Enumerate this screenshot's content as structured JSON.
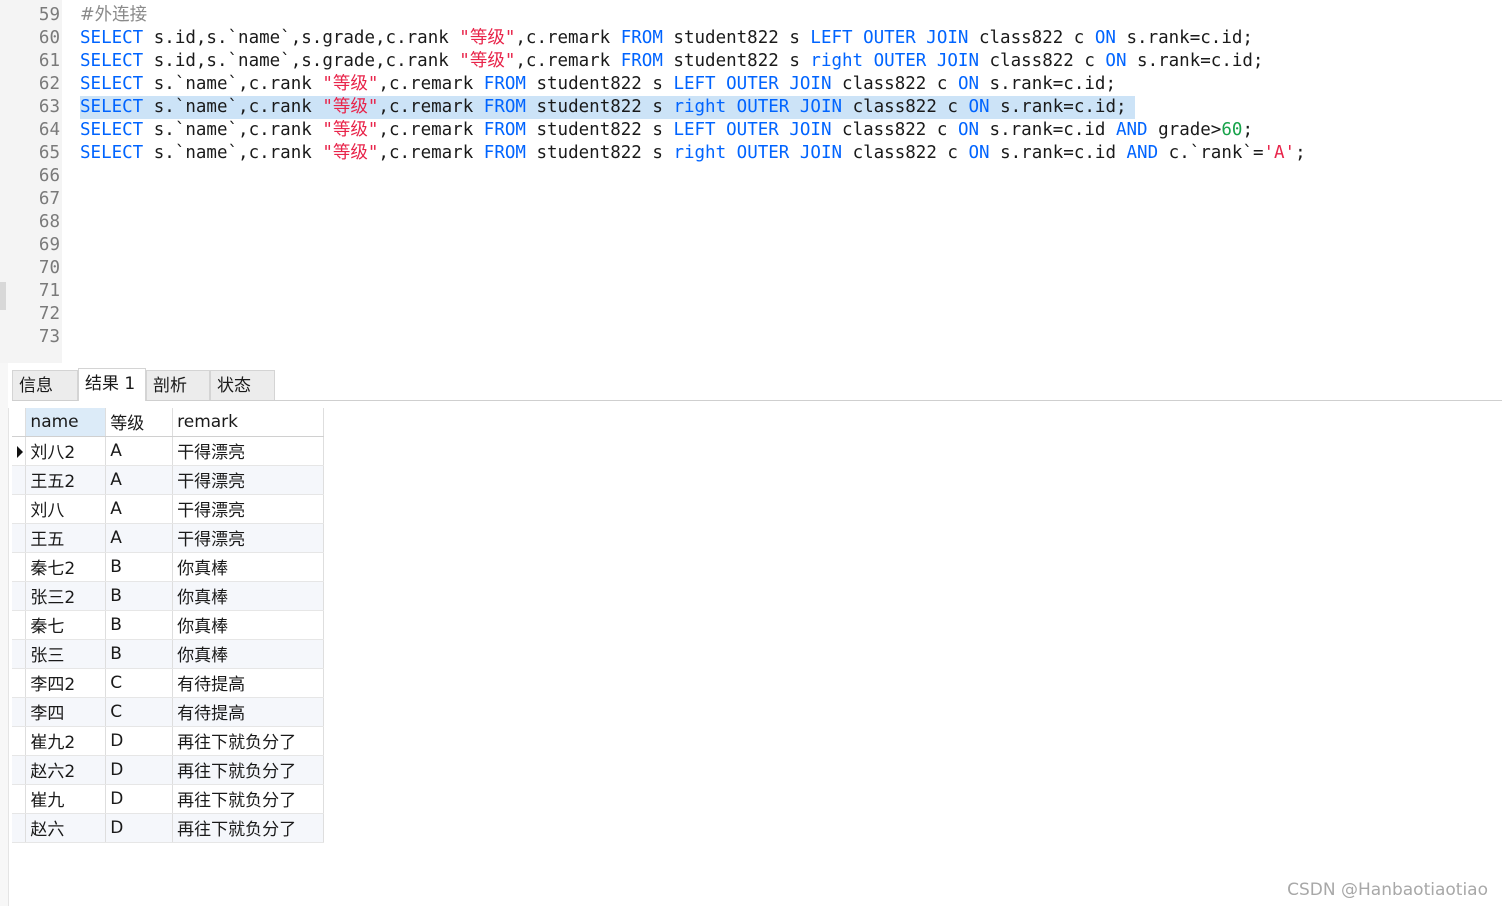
{
  "editor": {
    "lines": [
      {
        "num": "59",
        "highlight": false,
        "tokens": [
          [
            "cm",
            "#外连接"
          ]
        ]
      },
      {
        "num": "60",
        "highlight": false,
        "tokens": [
          [
            "kw",
            "SELECT"
          ],
          [
            "id",
            " s.id,s.`name`,s.grade,c.rank "
          ],
          [
            "str",
            "\"等级\""
          ],
          [
            "id",
            ",c.remark "
          ],
          [
            "kw",
            "FROM"
          ],
          [
            "id",
            " student822 s "
          ],
          [
            "kw",
            "LEFT OUTER JOIN"
          ],
          [
            "id",
            " class822 c "
          ],
          [
            "kw",
            "ON"
          ],
          [
            "id",
            " s.rank=c.id;"
          ]
        ]
      },
      {
        "num": "61",
        "highlight": false,
        "tokens": [
          [
            "kw",
            "SELECT"
          ],
          [
            "id",
            " s.id,s.`name`,s.grade,c.rank "
          ],
          [
            "str",
            "\"等级\""
          ],
          [
            "id",
            ",c.remark "
          ],
          [
            "kw",
            "FROM"
          ],
          [
            "id",
            " student822 s "
          ],
          [
            "kw",
            "right OUTER JOIN"
          ],
          [
            "id",
            " class822 c "
          ],
          [
            "kw",
            "ON"
          ],
          [
            "id",
            " s.rank=c.id;"
          ]
        ]
      },
      {
        "num": "62",
        "highlight": false,
        "tokens": [
          [
            "kw",
            "SELECT"
          ],
          [
            "id",
            " s.`name`,c.rank "
          ],
          [
            "str",
            "\"等级\""
          ],
          [
            "id",
            ",c.remark "
          ],
          [
            "kw",
            "FROM"
          ],
          [
            "id",
            " student822 s "
          ],
          [
            "kw",
            "LEFT OUTER JOIN"
          ],
          [
            "id",
            " class822 c "
          ],
          [
            "kw",
            "ON"
          ],
          [
            "id",
            " s.rank=c.id;"
          ]
        ]
      },
      {
        "num": "63",
        "highlight": true,
        "tokens": [
          [
            "kw",
            "SELECT"
          ],
          [
            "id",
            " s.`name`,c.rank "
          ],
          [
            "str",
            "\"等级\""
          ],
          [
            "id",
            ",c.remark "
          ],
          [
            "kw",
            "FROM"
          ],
          [
            "id",
            " student822 s "
          ],
          [
            "kw",
            "right OUTER JOIN"
          ],
          [
            "id",
            " class822 c "
          ],
          [
            "kw",
            "ON"
          ],
          [
            "id",
            " s.rank=c.id;"
          ]
        ]
      },
      {
        "num": "64",
        "highlight": false,
        "tokens": [
          [
            "kw",
            "SELECT"
          ],
          [
            "id",
            " s.`name`,c.rank "
          ],
          [
            "str",
            "\"等级\""
          ],
          [
            "id",
            ",c.remark "
          ],
          [
            "kw",
            "FROM"
          ],
          [
            "id",
            " student822 s "
          ],
          [
            "kw",
            "LEFT OUTER JOIN"
          ],
          [
            "id",
            " class822 c "
          ],
          [
            "kw",
            "ON"
          ],
          [
            "id",
            " s.rank=c.id "
          ],
          [
            "kw",
            "AND"
          ],
          [
            "id",
            " grade>"
          ],
          [
            "num",
            "60"
          ],
          [
            "id",
            ";"
          ]
        ]
      },
      {
        "num": "65",
        "highlight": false,
        "tokens": [
          [
            "kw",
            "SELECT"
          ],
          [
            "id",
            " s.`name`,c.rank "
          ],
          [
            "str",
            "\"等级\""
          ],
          [
            "id",
            ",c.remark "
          ],
          [
            "kw",
            "FROM"
          ],
          [
            "id",
            " student822 s "
          ],
          [
            "kw",
            "right OUTER JOIN"
          ],
          [
            "id",
            " class822 c "
          ],
          [
            "kw",
            "ON"
          ],
          [
            "id",
            " s.rank=c.id "
          ],
          [
            "kw",
            "AND"
          ],
          [
            "id",
            " c.`rank`="
          ],
          [
            "str",
            "'A'"
          ],
          [
            "id",
            ";"
          ]
        ]
      },
      {
        "num": "66",
        "highlight": false,
        "tokens": []
      },
      {
        "num": "67",
        "highlight": false,
        "tokens": []
      },
      {
        "num": "68",
        "highlight": false,
        "tokens": []
      },
      {
        "num": "69",
        "highlight": false,
        "tokens": []
      },
      {
        "num": "70",
        "highlight": false,
        "tokens": []
      },
      {
        "num": "71",
        "highlight": false,
        "tokens": []
      },
      {
        "num": "72",
        "highlight": false,
        "tokens": []
      },
      {
        "num": "73",
        "highlight": false,
        "tokens": []
      }
    ]
  },
  "tabs": {
    "info": "信息",
    "result": "结果 1",
    "profile": "剖析",
    "status": "状态",
    "active": "result"
  },
  "grid": {
    "headers": [
      "name",
      "等级",
      "remark"
    ],
    "rows": [
      [
        "刘八2",
        "A",
        "干得漂亮"
      ],
      [
        "王五2",
        "A",
        "干得漂亮"
      ],
      [
        "刘八",
        "A",
        "干得漂亮"
      ],
      [
        "王五",
        "A",
        "干得漂亮"
      ],
      [
        "秦七2",
        "B",
        "你真棒"
      ],
      [
        "张三2",
        "B",
        "你真棒"
      ],
      [
        "秦七",
        "B",
        "你真棒"
      ],
      [
        "张三",
        "B",
        "你真棒"
      ],
      [
        "李四2",
        "C",
        "有待提高"
      ],
      [
        "李四",
        "C",
        "有待提高"
      ],
      [
        "崔九2",
        "D",
        "再往下就负分了"
      ],
      [
        "赵六2",
        "D",
        "再往下就负分了"
      ],
      [
        "崔九",
        "D",
        "再往下就负分了"
      ],
      [
        "赵六",
        "D",
        "再往下就负分了"
      ]
    ]
  },
  "watermark": "CSDN @Hanbaotiaotiao",
  "colors": {
    "keyword": "#0064ff",
    "string": "#e8244a",
    "number": "#17a34a",
    "selection": "#cce3f7"
  }
}
